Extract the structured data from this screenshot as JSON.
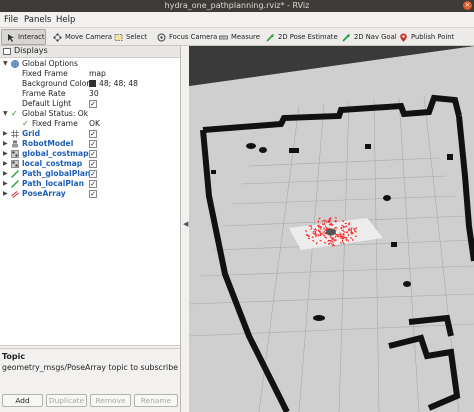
{
  "window": {
    "title": "hydra_one_pathplanning.rviz* - RViz"
  },
  "menu": [
    "File",
    "Panels",
    "Help"
  ],
  "toolbar": [
    {
      "label": "Interact",
      "icon": "interact-icon",
      "active": true
    },
    {
      "label": "Move Camera",
      "icon": "move-camera-icon"
    },
    {
      "label": "Select",
      "icon": "select-icon"
    },
    {
      "label": "Focus Camera",
      "icon": "focus-camera-icon"
    },
    {
      "label": "Measure",
      "icon": "measure-icon"
    },
    {
      "label": "2D Pose Estimate",
      "icon": "pose-estimate-icon"
    },
    {
      "label": "2D Nav Goal",
      "icon": "nav-goal-icon"
    },
    {
      "label": "Publish Point",
      "icon": "publish-point-icon"
    }
  ],
  "displays_panel": {
    "title": "Displays",
    "global_options": {
      "label": "Global Options",
      "fixed_frame_label": "Fixed Frame",
      "fixed_frame_value": "map",
      "background_color_label": "Background Color",
      "background_color_value": "48; 48; 48",
      "background_color_hex": "#303030",
      "frame_rate_label": "Frame Rate",
      "frame_rate_value": "30",
      "default_light_label": "Default Light"
    },
    "global_status": {
      "label": "Global Status: Ok",
      "fixed_frame_label": "Fixed Frame",
      "fixed_frame_value": "OK"
    },
    "displays": [
      {
        "name": "Grid",
        "icon": "grid-icon",
        "enabled": true
      },
      {
        "name": "RobotModel",
        "icon": "robot-model-icon",
        "enabled": true
      },
      {
        "name": "global_costmap",
        "icon": "map-icon",
        "enabled": true
      },
      {
        "name": "local_costmap",
        "icon": "map-icon",
        "enabled": true
      },
      {
        "name": "Path_globalPlan",
        "icon": "path-icon",
        "enabled": true
      },
      {
        "name": "Path_localPlan",
        "icon": "path-icon",
        "enabled": true
      },
      {
        "name": "PoseArray",
        "icon": "pose-array-icon",
        "enabled": true
      }
    ]
  },
  "topic": {
    "title": "Topic",
    "description": "geometry_msgs/PoseArray topic to subscribe to."
  },
  "buttons": {
    "add": "Add",
    "duplicate": "Duplicate",
    "remove": "Remove",
    "rename": "Rename"
  },
  "colors": {
    "accent_link": "#1d5fb8",
    "particles": "#ff2020",
    "map_free": "#cfcfcf",
    "map_wall": "#101010"
  }
}
